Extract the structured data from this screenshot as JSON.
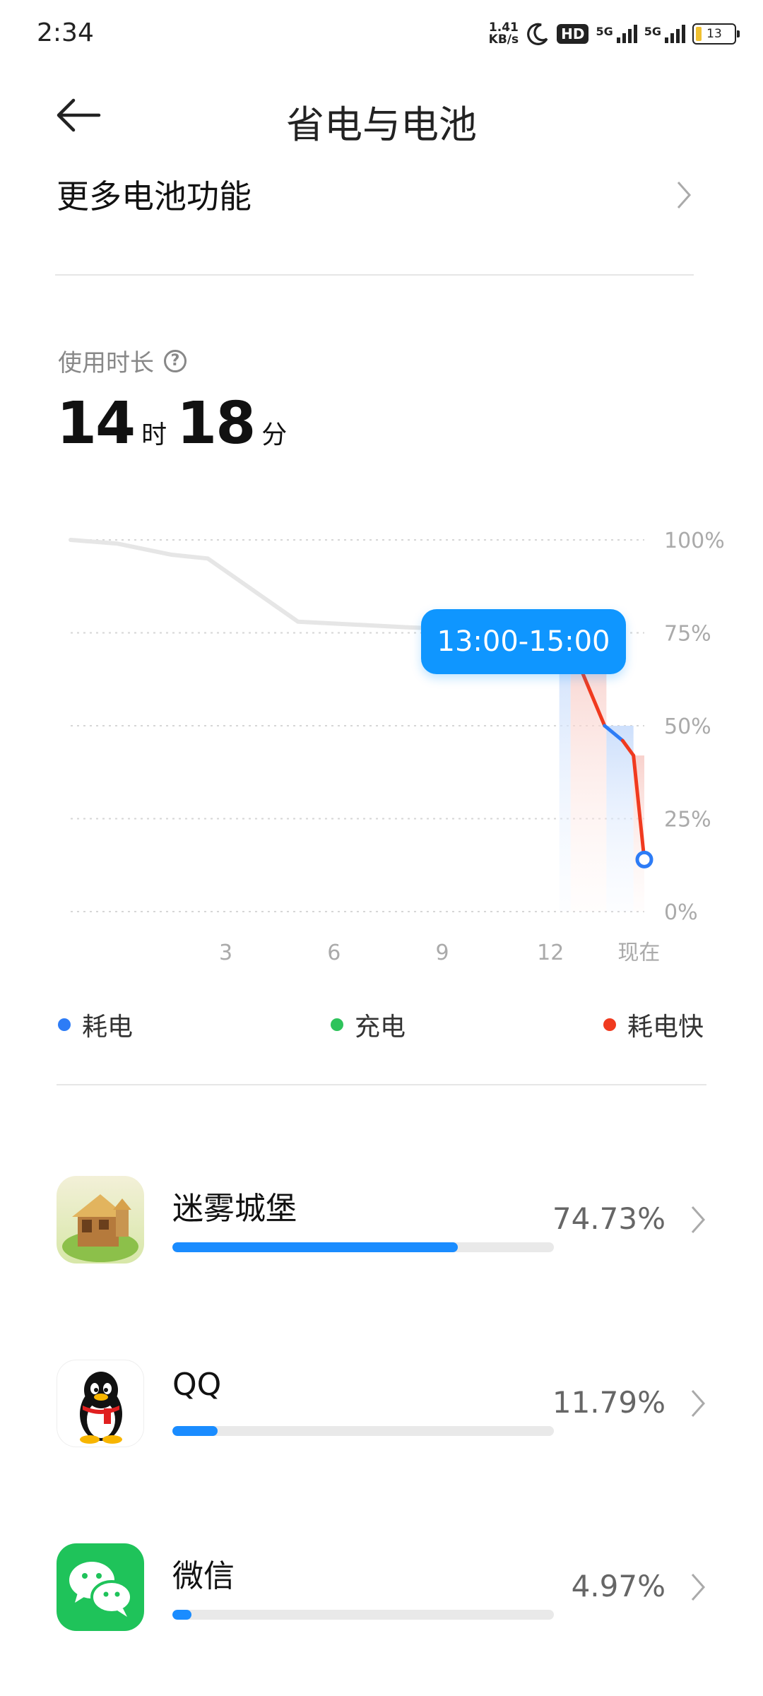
{
  "status_bar": {
    "time": "2:34",
    "net_speed_value": "1.41",
    "net_speed_unit": "KB/s",
    "hd": "HD",
    "sim1": "5G",
    "sim2": "5G",
    "battery": "13"
  },
  "header": {
    "title": "省电与电池"
  },
  "more_battery": {
    "label": "更多电池功能"
  },
  "usage": {
    "label": "使用时长",
    "hours": "14",
    "hours_unit": "时",
    "minutes": "18",
    "minutes_unit": "分"
  },
  "chart_data": {
    "type": "line",
    "x_ticks": [
      "3",
      "6",
      "9",
      "12",
      "现在"
    ],
    "y_ticks": [
      "100%",
      "75%",
      "50%",
      "25%",
      "0%"
    ],
    "ylim": [
      0,
      100
    ],
    "xlim": [
      -1.3,
      14.6
    ],
    "selected_range_label": "13:00-15:00",
    "grid": true,
    "series": [
      {
        "name": "",
        "x": [
          -1.3,
          0,
          1.5,
          2.5,
          5,
          8,
          10,
          12.4
        ],
        "values": [
          100,
          99,
          96,
          95,
          78,
          76.5,
          75.7,
          75.5
        ]
      },
      {
        "name": "",
        "x": [
          12.4,
          13.5,
          14.0,
          14.3,
          14.6
        ],
        "values": [
          75.5,
          50,
          46,
          42,
          14
        ]
      }
    ],
    "legend": [
      {
        "label": "耗电",
        "color": "#2d7cf6"
      },
      {
        "label": "充电",
        "color": "#2ec35b"
      },
      {
        "label": "耗电快",
        "color": "#f03a1f"
      }
    ]
  },
  "apps": [
    {
      "name": "迷雾城堡",
      "percent": "74.73%",
      "share": 0.7473,
      "icon": "castle-app-icon"
    },
    {
      "name": "QQ",
      "percent": "11.79%",
      "share": 0.1179,
      "icon": "qq-penguin-icon"
    },
    {
      "name": "微信",
      "percent": "4.97%",
      "share": 0.0497,
      "icon": "wechat-icon"
    }
  ]
}
